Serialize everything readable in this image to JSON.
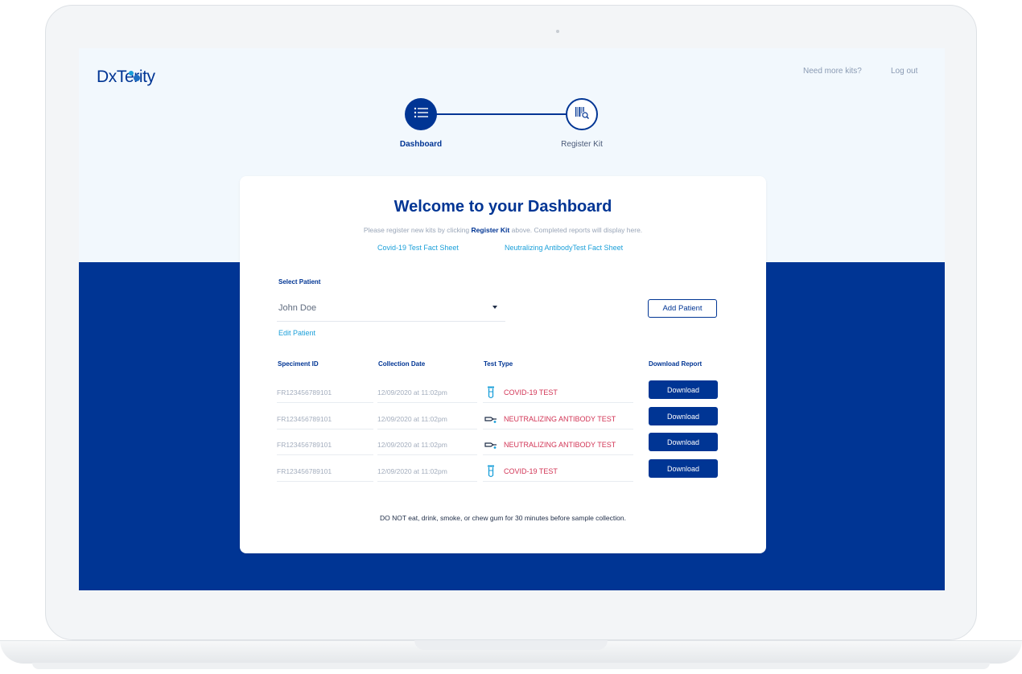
{
  "header": {
    "logo_text": "DxTerity",
    "links": {
      "more_kits": "Need more kits?",
      "logout": "Log out"
    }
  },
  "stepper": {
    "steps": [
      {
        "label": "Dashboard",
        "icon": "list-icon",
        "active": true
      },
      {
        "label": "Register Kit",
        "icon": "barcode-search-icon",
        "active": false
      }
    ]
  },
  "card": {
    "title": "Welcome to your Dashboard",
    "subtext_before": "Please register new kits by clicking",
    "subtext_bold": "Register Kit",
    "subtext_after": "above. Completed reports will display here.",
    "fact_sheet_1": "Covid-19 Test Fact Sheet",
    "fact_sheet_2": "Neutralizing AntibodyTest Fact Sheet",
    "select_label": "Select Patient",
    "selected_patient": "John Doe",
    "add_patient": "Add Patient",
    "edit_patient": "Edit Patient",
    "notice": "DO NOT eat, drink, smoke, or chew gum for 30 minutes before sample collection."
  },
  "table": {
    "headers": [
      "Speciment ID",
      "Collection Date",
      "Test Type",
      "Download Report"
    ],
    "rows": [
      {
        "id": "FR123456789101",
        "date": "12/09/2020 at 11:02pm",
        "type": "COVID-19 TEST",
        "icon": "test-tube-icon",
        "action": "Download"
      },
      {
        "id": "FR123456789101",
        "date": "12/09/2020 at 11:02pm",
        "type": "NEUTRALIZING ANTIBODY TEST",
        "icon": "lancet-icon",
        "action": "Download"
      },
      {
        "id": "FR123456789101",
        "date": "12/09/2020 at 11:02pm",
        "type": "NEUTRALIZING ANTIBODY TEST",
        "icon": "lancet-icon",
        "action": "Download"
      },
      {
        "id": "FR123456789101",
        "date": "12/09/2020 at 11:02pm",
        "type": "COVID-19 TEST",
        "icon": "test-tube-icon",
        "action": "Download"
      }
    ]
  },
  "colors": {
    "brand_navy": "#003594",
    "accent_cyan": "#1a9fd9",
    "test_type_red": "#d23455",
    "screen_bg": "#f2f8fd"
  }
}
